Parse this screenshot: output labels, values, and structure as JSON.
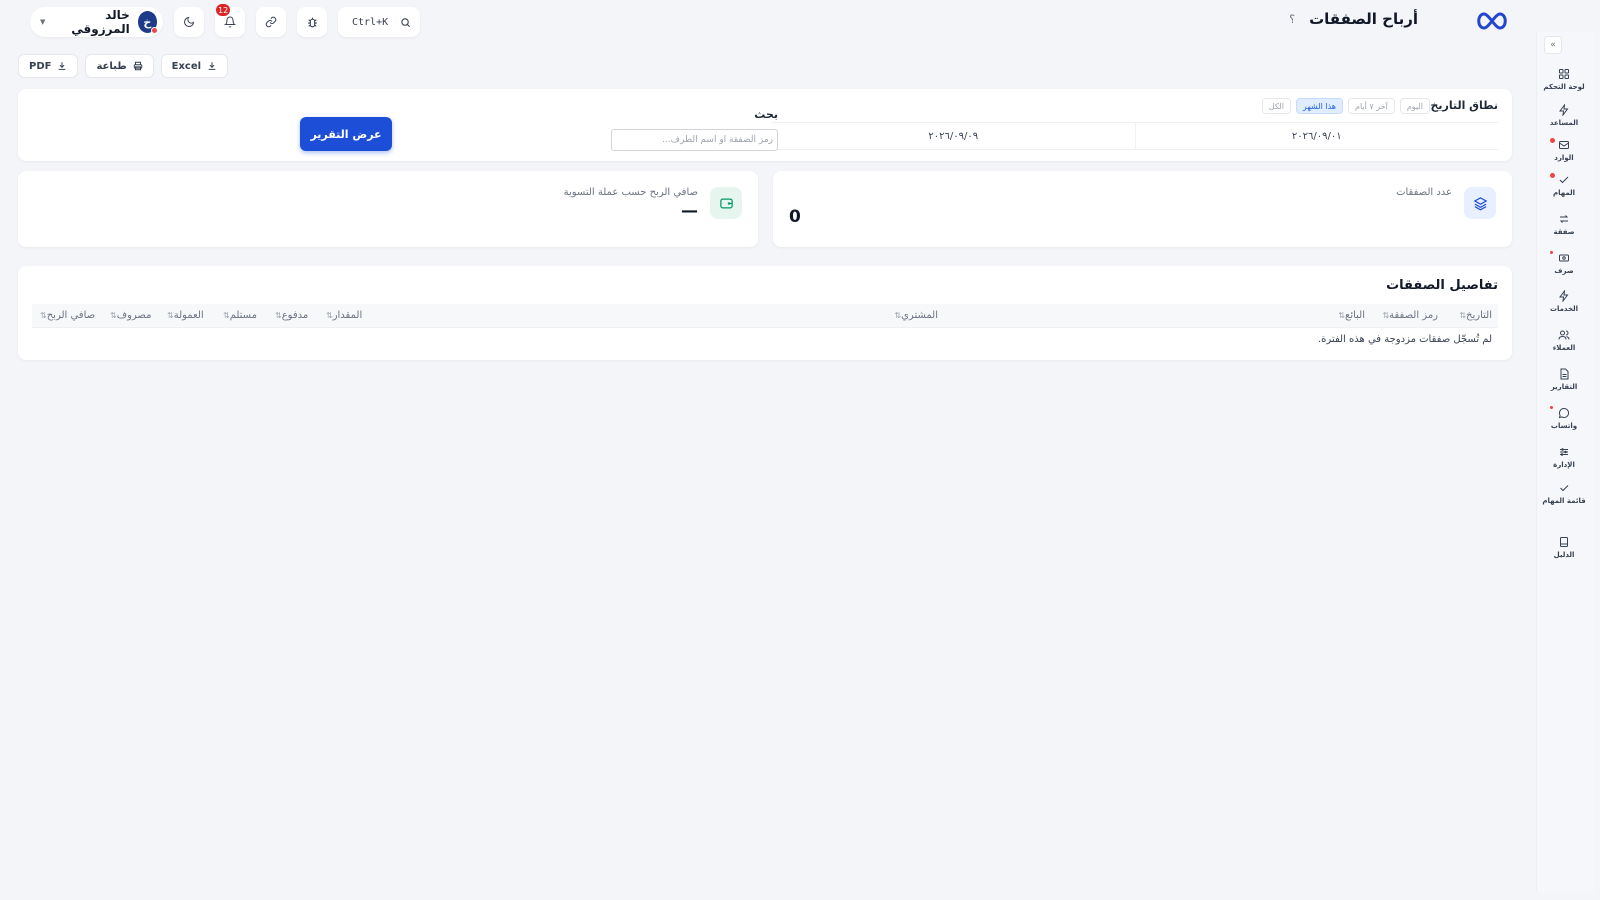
{
  "header": {
    "title": "أرباح الصفقات",
    "help": "؟",
    "user_name": "خالد المرزوقي",
    "avatar_initial": "خ",
    "notifications_count": "12",
    "search_shortcut": "Ctrl+K"
  },
  "exports": {
    "excel": "Excel",
    "print": "طباعة",
    "pdf": "PDF"
  },
  "filters": {
    "range_label": "نطاق التاريخ",
    "chips": [
      "اليوم",
      "آخر ٧ أيام",
      "هذا الشهر",
      "الكل"
    ],
    "active_chip": "هذا الشهر",
    "date_from": "٢٠٢٦/٠٩/٠١",
    "date_to": "٢٠٢٦/٠٩/٠٩",
    "search_label": "بحث",
    "search_placeholder": "رمز الصفقة أو اسم الطرف...",
    "search_value": "",
    "submit_label": "عرض التقرير"
  },
  "stats": {
    "deals_count_label": "عدد الصفقات",
    "deals_count_value": "0",
    "net_profit_label": "صافي الربح حسب عملة التسوية",
    "net_profit_value": "—"
  },
  "table": {
    "title": "تفاصيل الصفقات",
    "columns": {
      "date": "التاريخ",
      "code": "رمز الصفقة",
      "seller": "البائع",
      "buyer": "المشتري",
      "amount": "المقدار",
      "paid": "مدفوع",
      "received": "مستلم",
      "commission": "العمولة",
      "expense": "مصروف",
      "net_profit": "صافي الربح"
    },
    "sort_mark": "⇅",
    "empty_message": "لم تُسجّل صفقات مزدوجة في هذه الفترة."
  },
  "sidebar": {
    "collapse": "«",
    "items": [
      {
        "label": "لوحة التحكم",
        "icon": "dashboard-icon"
      },
      {
        "label": "المساعد",
        "icon": "lightning-icon"
      },
      {
        "label": "الوارد",
        "icon": "inbox-icon"
      },
      {
        "label": "المهام",
        "icon": "check-icon"
      },
      {
        "label": "صفقة",
        "icon": "swap-icon"
      },
      {
        "label": "صرف",
        "icon": "cash-icon"
      },
      {
        "label": "الخدمات",
        "icon": "lightning-icon"
      },
      {
        "label": "العملاء",
        "icon": "users-icon"
      },
      {
        "label": "التقارير",
        "icon": "report-icon"
      },
      {
        "label": "واتساب",
        "icon": "chat-icon"
      },
      {
        "label": "الإدارة",
        "icon": "sliders-icon"
      },
      {
        "label": "قائمة المهام",
        "icon": "checklist-icon"
      },
      {
        "label": "الدليل",
        "icon": "book-icon"
      }
    ]
  },
  "colors": {
    "accent": "#1d4ed8",
    "background": "#f3f5f9",
    "badge": "#dc2626",
    "stat_icon_blue": "#e8efff",
    "stat_icon_green": "#e6f6ef"
  }
}
